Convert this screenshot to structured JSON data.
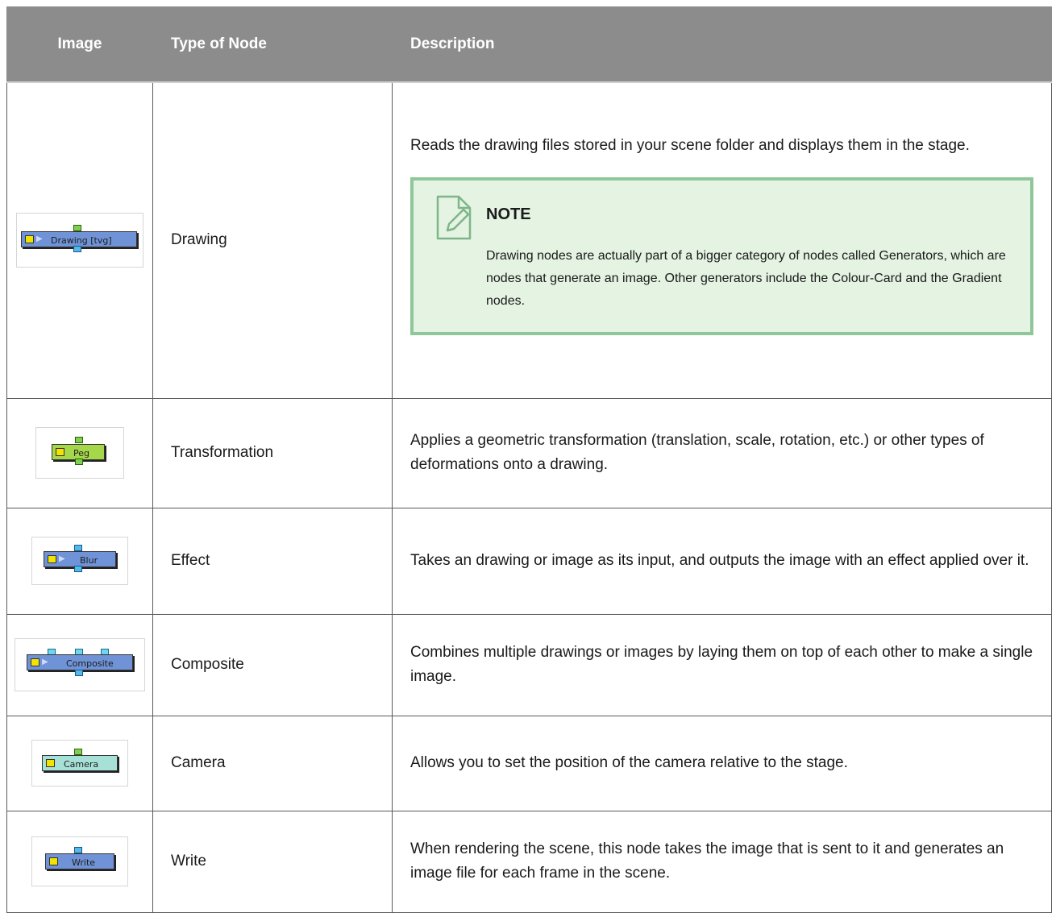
{
  "headers": {
    "image": "Image",
    "type": "Type of Node",
    "description": "Description"
  },
  "rows": [
    {
      "node_label": "Drawing [tvg]",
      "node_color": "#6f93d6",
      "type": "Drawing",
      "description": "Reads the drawing files stored in your scene folder and displays them in the stage.",
      "note": {
        "title": "NOTE",
        "body": "Drawing nodes are actually part of a bigger category of nodes called Generators, which are nodes that generate an image. Other generators include the Colour-Card and the Gradient nodes.",
        "icon": "note-pencil-icon"
      }
    },
    {
      "node_label": "Peg",
      "node_color": "#a6d64a",
      "type": "Transformation",
      "description": "Applies a geometric transformation (translation, scale, rotation, etc.) or other types of deformations onto a drawing."
    },
    {
      "node_label": "Blur",
      "node_color": "#6f93d6",
      "type": "Effect",
      "description": "Takes an drawing or image as its input, and outputs the image with an effect applied over it."
    },
    {
      "node_label": "Composite",
      "node_color": "#6f93d6",
      "type": "Composite",
      "description": "Combines multiple drawings or images by laying them on top of each other to make a single image."
    },
    {
      "node_label": "Camera",
      "node_color": "#a7e0d6",
      "type": "Camera",
      "description": "Allows you to set the position of the camera relative to the stage."
    },
    {
      "node_label": "Write",
      "node_color": "#6f93d6",
      "type": "Write",
      "description": "When rendering the scene, this node takes the image that is sent to it and generates an image file for each frame in the scene."
    }
  ]
}
